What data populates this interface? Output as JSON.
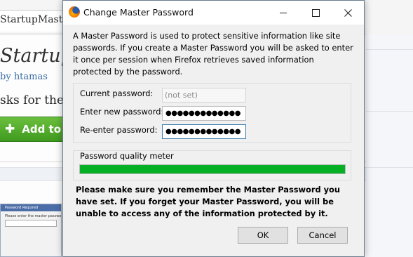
{
  "background": {
    "tab_title": "StartupMaster",
    "addon_title": "StartupM",
    "author_prefix": "by ",
    "author_name": "htamas",
    "description": "sks for the m",
    "add_button": "Add to F",
    "thumbnail_title": "Password Required",
    "thumbnail_text": "Please enter the master password"
  },
  "dialog": {
    "title": "Change Master Password",
    "intro": "A Master Password is used to protect sensitive information like site passwords. If you create a Master Password you will be asked to enter it once per session when Firefox retrieves saved information protected by the password.",
    "current_password_label": "Current password:",
    "current_password_value": "(not set)",
    "new_password_label": "Enter new password:",
    "new_password_value": "●●●●●●●●●●●●●",
    "reenter_password_label": "Re-enter password:",
    "reenter_password_value": "●●●●●●●●●●●●●",
    "quality_meter_label": "Password quality meter",
    "quality_meter_value": 1.0,
    "warning": "Please make sure you remember the Master Password you have set. If you forget your Master Password, you will be unable to access any of the information protected by it.",
    "ok_label": "OK",
    "cancel_label": "Cancel"
  },
  "colors": {
    "meter_fill": "#06b025",
    "add_button": "#4fa82b",
    "link": "#3a6ba5"
  },
  "icons": [
    "firefox-icon",
    "minimize-icon",
    "maximize-icon",
    "close-icon",
    "plus-icon"
  ]
}
